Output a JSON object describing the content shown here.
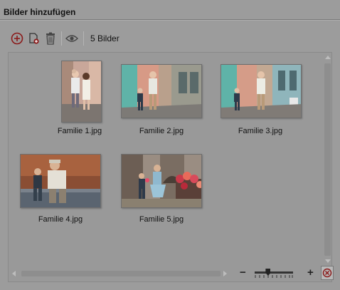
{
  "header": {
    "title": "Bilder hinzufügen"
  },
  "toolbar": {
    "icons": [
      "add-icon",
      "add-file-icon",
      "trash-icon",
      "eye-icon"
    ],
    "count_label": "5 Bilder"
  },
  "images": [
    {
      "label": "Familie 1.jpg"
    },
    {
      "label": "Familie 2.jpg"
    },
    {
      "label": "Familie 3.jpg"
    },
    {
      "label": "Familie 4.jpg"
    },
    {
      "label": "Familie 5.jpg"
    }
  ],
  "zoom": {
    "minus_label": "−",
    "plus_label": "+",
    "level": 0.35
  },
  "colors": {
    "background": "#9c9c9c",
    "accent_red": "#8b1a1a"
  }
}
